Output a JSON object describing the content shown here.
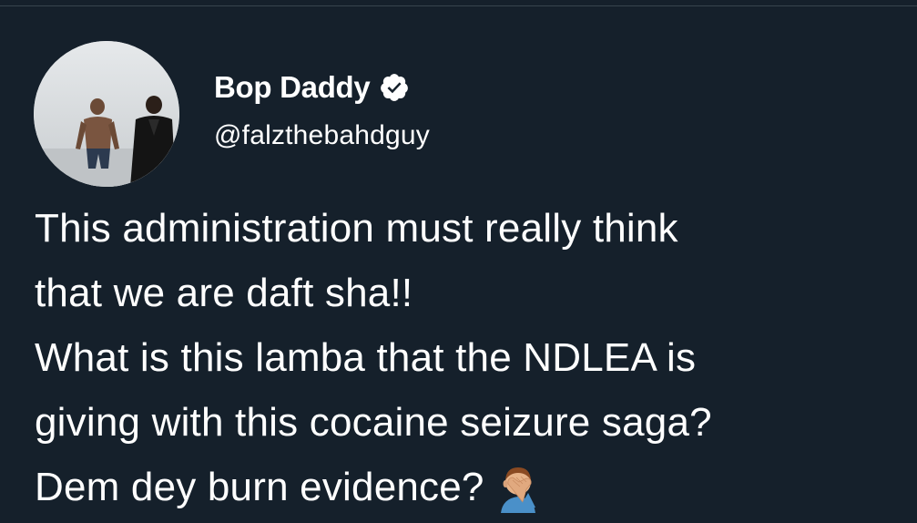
{
  "author": {
    "display_name": "Bop Daddy",
    "handle": "@falzthebahdguy",
    "verified": true,
    "avatar_icon": "profile-photo-icon",
    "verified_icon": "verified-badge-icon",
    "verified_color": "#ffffff"
  },
  "tweet": {
    "lines": [
      "This administration must really think",
      "that we are daft sha!!",
      "What is this lamba that the NDLEA is",
      "giving with this cocaine seizure saga?",
      "Dem dey burn evidence?"
    ],
    "trailing_emoji": "man-facepalming-emoji"
  },
  "theme": {
    "background": "#15202b",
    "text": "#ffffff",
    "divider": "#38444d"
  }
}
